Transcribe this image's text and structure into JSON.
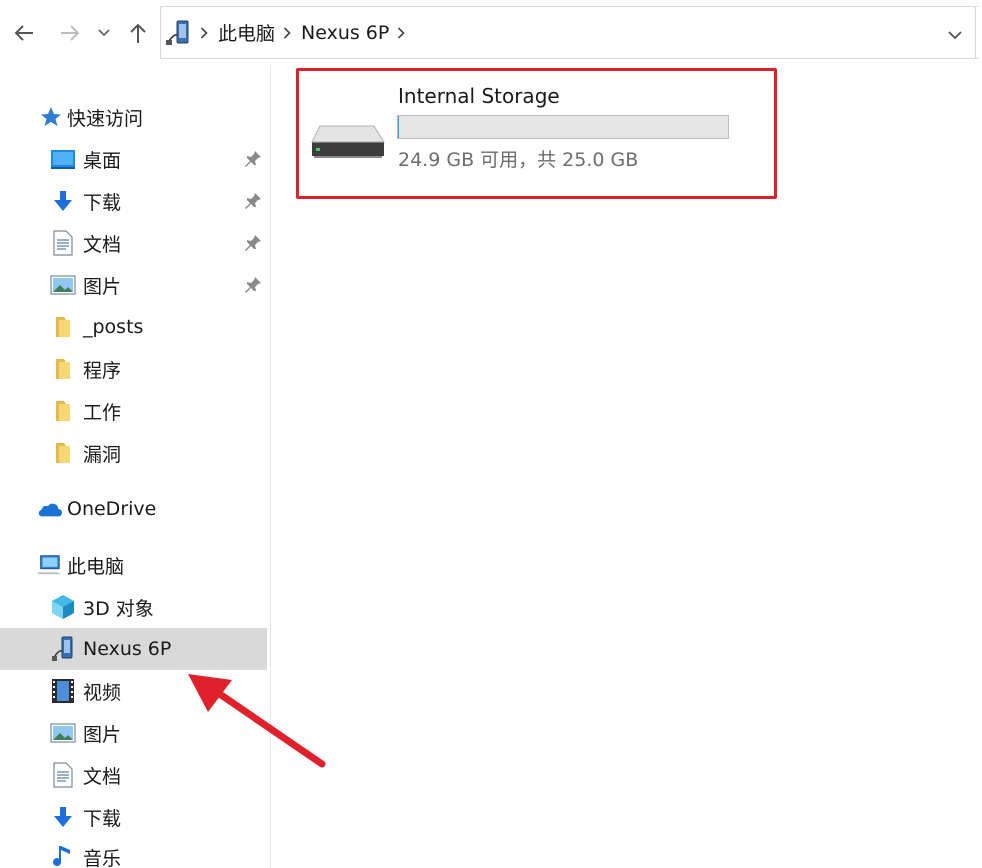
{
  "address_bar": {
    "breadcrumbs": [
      "此电脑",
      "Nexus 6P"
    ]
  },
  "sidebar": {
    "quick_access": {
      "label": "快速访问",
      "items": [
        {
          "label": "桌面",
          "icon": "desktop-icon",
          "pinned": true
        },
        {
          "label": "下载",
          "icon": "download-icon",
          "pinned": true
        },
        {
          "label": "文档",
          "icon": "document-icon",
          "pinned": true
        },
        {
          "label": "图片",
          "icon": "picture-icon",
          "pinned": true
        },
        {
          "label": "_posts",
          "icon": "folder-icon",
          "pinned": false
        },
        {
          "label": "程序",
          "icon": "folder-icon",
          "pinned": false
        },
        {
          "label": "工作",
          "icon": "folder-icon",
          "pinned": false
        },
        {
          "label": "漏洞",
          "icon": "folder-icon",
          "pinned": false
        }
      ]
    },
    "onedrive": {
      "label": "OneDrive",
      "icon": "cloud-icon"
    },
    "this_pc": {
      "label": "此电脑",
      "items": [
        {
          "label": "3D 对象",
          "icon": "3d-objects-icon"
        },
        {
          "label": "Nexus 6P",
          "icon": "phone-device-icon",
          "selected": true
        },
        {
          "label": "视频",
          "icon": "video-icon"
        },
        {
          "label": "图片",
          "icon": "picture-icon"
        },
        {
          "label": "文档",
          "icon": "document-icon"
        },
        {
          "label": "下载",
          "icon": "download-icon"
        },
        {
          "label": "音乐",
          "icon": "music-icon"
        }
      ]
    }
  },
  "main": {
    "drive": {
      "name": "Internal Storage",
      "space_text": "24.9 GB 可用，共 25.0 GB",
      "used_fraction": 0.004,
      "icon": "hard-drive-icon"
    }
  },
  "colors": {
    "highlight_border": "#e0202a",
    "selected_bg": "#d9d9d9",
    "accent": "#26a0da"
  }
}
